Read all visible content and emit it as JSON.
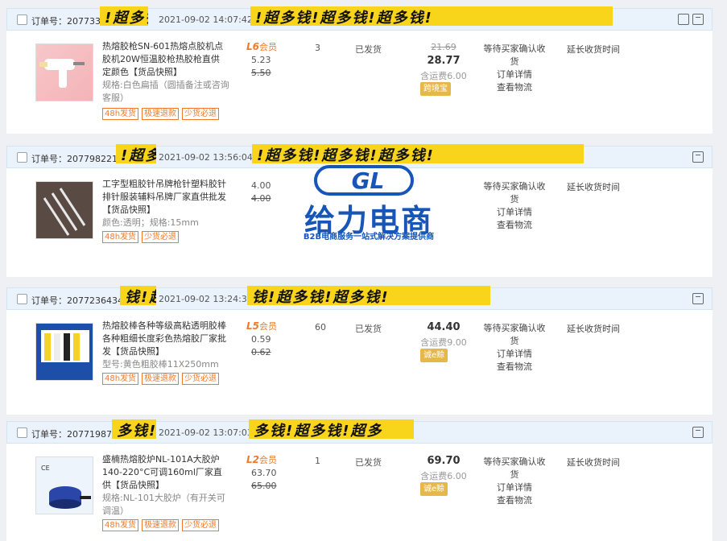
{
  "orders": [
    {
      "order_label": "订单号：20773392",
      "date": "2021-09-02 14:07:42",
      "banner_text": "!超多钱!超多钱!超多钱!",
      "title": "热熔胶枪SN-601热熔点胶机点胶机20W恒温胶枪热胶枪直供定颜色【货品快照】",
      "spec": "规格:白色扁插（圆插备注或咨询客服）",
      "services": [
        "48h发货",
        "极速退款",
        "少货必退"
      ],
      "member_label": "会员",
      "member_level": "L6",
      "unit_price": "5.23",
      "unit_price_old": "5.50",
      "qty": "3",
      "status": "已发货",
      "orig_total": "21.69",
      "total": "28.77",
      "shipping": "含运费6.00",
      "pay_badge": "跨境宝",
      "actions": [
        "等待买家确认收货",
        "订单详情",
        "查看物流"
      ],
      "extend": "延长收货时间",
      "image": "hot-glue-gun"
    },
    {
      "order_label": "订单号：20779822112",
      "date": "2021-09-02 13:56:04",
      "banner_text": "!超多钱!超多钱!超多钱!",
      "title": "工字型粗胶针吊牌枪针塑料胶针排针服装辅料吊牌厂家直供批发【货品快照】",
      "spec": "颜色:透明；规格:15mm",
      "services": [
        "48h发货",
        "少货必退"
      ],
      "member_label": "",
      "member_level": "",
      "unit_price": "4.00",
      "unit_price_old": "4.00",
      "qty": "",
      "status": "",
      "orig_total": "",
      "total": "",
      "shipping": "",
      "pay_badge": "",
      "actions": [
        "等待买家确认收货",
        "订单详情",
        "查看物流"
      ],
      "extend": "延长收货时间",
      "image": "plastic-pins"
    },
    {
      "order_label": "订单号：20772364349",
      "date": "2021-09-02 13:24:37",
      "banner_text": "钱!超多钱!超多钱!",
      "title": "热熔胶棒各种等级高粘透明胶棒各种粗细长度彩色热熔胶厂家批发【货品快照】",
      "spec": "型号:黄色粗胶棒11X250mm",
      "services": [
        "48h发货",
        "极速退款",
        "少货必退"
      ],
      "member_label": "会员",
      "member_level": "L5",
      "unit_price": "0.59",
      "unit_price_old": "0.62",
      "qty": "60",
      "status": "已发货",
      "orig_total": "",
      "total": "44.40",
      "shipping": "含运费9.00",
      "pay_badge": "诚e赊",
      "actions": [
        "等待买家确认收货",
        "订单详情",
        "查看物流"
      ],
      "extend": "延长收货时间",
      "image": "glue-sticks"
    },
    {
      "order_label": "订单号：2077198742",
      "date": "2021-09-02 13:07:03",
      "banner_text": "多钱!超多钱!超多",
      "title": "盛楠热熔胶炉NL-101A大胶炉140-220°C可调160ml厂家直供【货品快照】",
      "spec": "规格:NL-101大胶炉（有开关可调温）",
      "services": [
        "48h发货",
        "极速退款",
        "少货必退"
      ],
      "member_label": "会员",
      "member_level": "L2",
      "unit_price": "63.70",
      "unit_price_old": "65.00",
      "qty": "1",
      "status": "已发货",
      "orig_total": "",
      "total": "69.70",
      "shipping": "含运费6.00",
      "pay_badge": "诚e赊",
      "actions": [
        "等待买家确认收货",
        "订单详情",
        "查看物流"
      ],
      "extend": "延长收货时间",
      "image": "glue-pot"
    }
  ],
  "watermark": {
    "title": "给力电商",
    "subtitle": "B2B电商服务一站式解决方案提供商",
    "logo_text": "GL"
  },
  "colors": {
    "accent": "#f07a2a",
    "header_bg": "#eaf2fb",
    "banner": "#f8d41a",
    "brand_blue": "#1756b8"
  }
}
